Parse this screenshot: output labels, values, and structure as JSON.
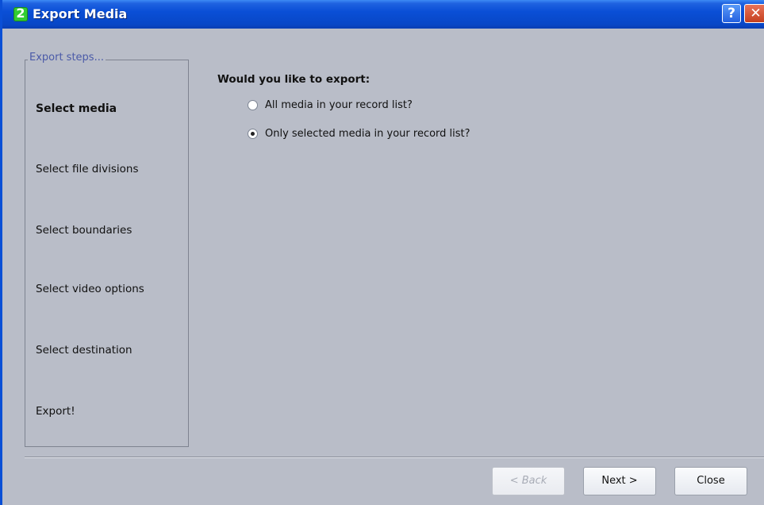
{
  "window": {
    "title": "Export Media"
  },
  "steps": {
    "legend": "Export steps...",
    "items": [
      {
        "label": "Select media",
        "active": true
      },
      {
        "label": "Select file divisions",
        "active": false
      },
      {
        "label": "Select boundaries",
        "active": false
      },
      {
        "label": "Select video options",
        "active": false
      },
      {
        "label": "Select destination",
        "active": false
      },
      {
        "label": "Export!",
        "active": false
      }
    ]
  },
  "main": {
    "question": "Would you like to export:",
    "options": [
      {
        "label": "All media in your record list?",
        "checked": false
      },
      {
        "label": "Only selected media in your record list?",
        "checked": true
      }
    ]
  },
  "buttons": {
    "back": "< Back",
    "next": "Next >",
    "close": "Close"
  },
  "colors": {
    "titlebar": "#0a4fd6",
    "background": "#b9bdc8",
    "legend_text": "#4a5aa8"
  },
  "icons": [
    "app-logo-icon",
    "help-icon",
    "close-icon"
  ]
}
